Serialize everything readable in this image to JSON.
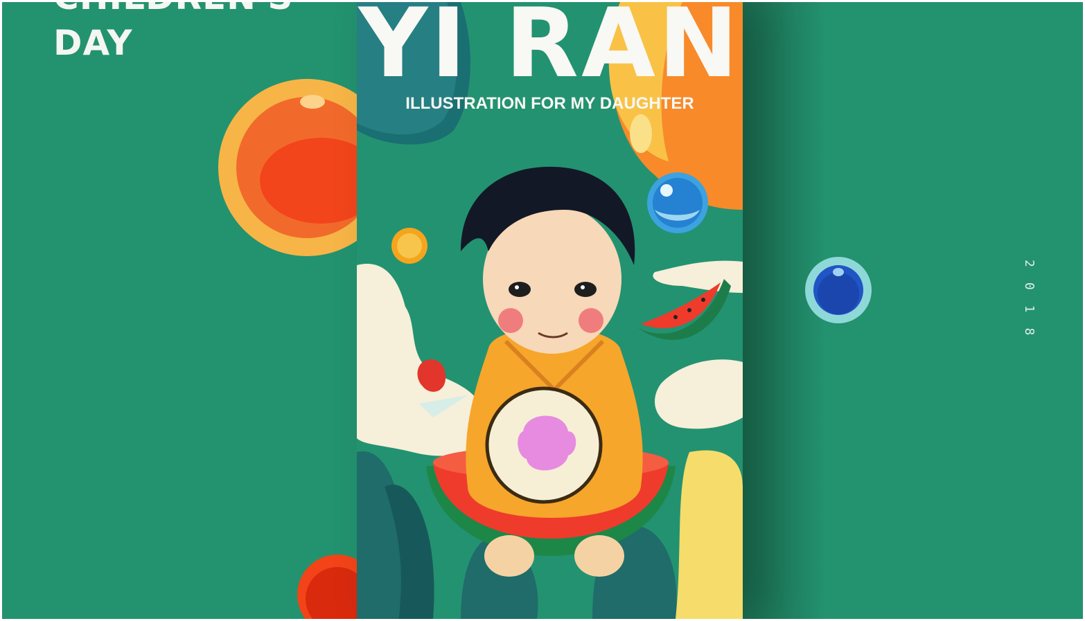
{
  "left_panel": {
    "title_line1": "CHILDREN'S",
    "title_line2": "DAY"
  },
  "poster": {
    "title": "YI RAN",
    "subtitle": "ILLUSTRATION FOR  MY  DAUGHTER"
  },
  "right_panel": {
    "year": "2018"
  },
  "colors": {
    "background": "#23926f",
    "orange": "#f46a2a",
    "ring": "#f9c041",
    "blue": "#1f55c4",
    "blue_ring": "#8fd8d8"
  }
}
